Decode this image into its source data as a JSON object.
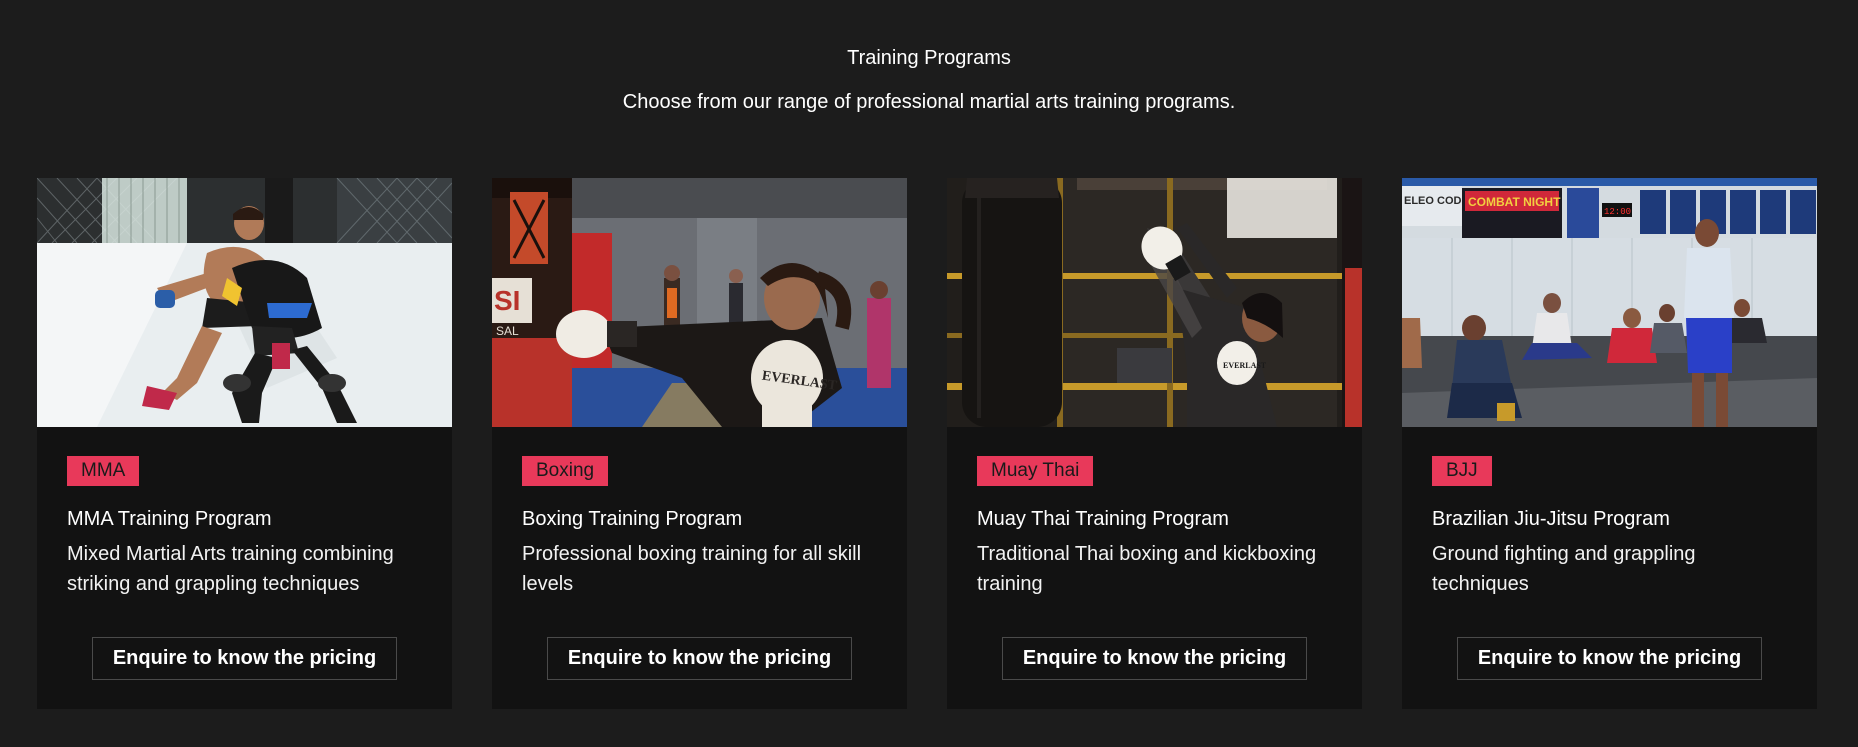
{
  "header": {
    "title": "Training Programs",
    "subtitle": "Choose from our range of professional martial arts training programs."
  },
  "cards": [
    {
      "tag": "MMA",
      "title": "MMA Training Program",
      "description": "Mixed Martial Arts training combining striking and grappling techniques",
      "button": "Enquire to know the pricing",
      "image_alt": "mma-fighters-photo"
    },
    {
      "tag": "Boxing",
      "title": "Boxing Training Program",
      "description": "Professional boxing training for all skill levels",
      "button": "Enquire to know the pricing",
      "image_alt": "boxer-punching-bag-photo"
    },
    {
      "tag": "Muay Thai",
      "title": "Muay Thai Training Program",
      "description": "Traditional Thai boxing and kickboxing training",
      "button": "Enquire to know the pricing",
      "image_alt": "muay-thai-kick-photo"
    },
    {
      "tag": "BJJ",
      "title": "Brazilian Jiu-Jitsu Program",
      "description": "Ground fighting and grappling techniques",
      "button": "Enquire to know the pricing",
      "image_alt": "bjj-class-photo"
    }
  ],
  "colors": {
    "background": "#1c1c1c",
    "card": "#121212",
    "accent": "#e8395a",
    "button_border": "#4a4a4a"
  },
  "image_text": {
    "bjj_banner": "COMBAT NIGHT",
    "bjj_code": "ELEO CODE",
    "bjj_score": "12:00",
    "boxing_bag": "SI",
    "boxing_bag_sub": "SAL",
    "boxing_glove": "EVERLAST",
    "muay_glove": "EVERLAST"
  }
}
